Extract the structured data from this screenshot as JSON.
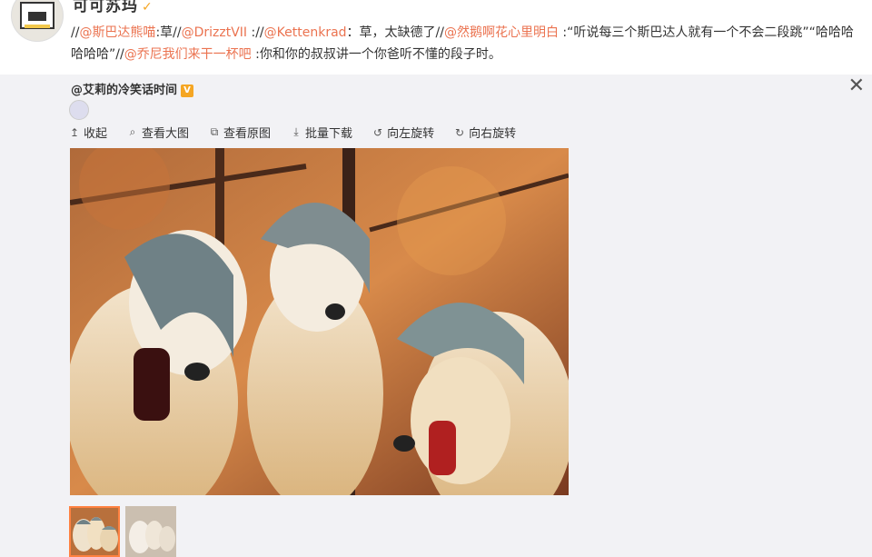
{
  "post": {
    "username": "可可苏玛",
    "segments": [
      {
        "text": "//",
        "type": "plain"
      },
      {
        "text": "@斯巴达熊喵",
        "type": "mention"
      },
      {
        "text": ":草//",
        "type": "plain"
      },
      {
        "text": "@DrizztVII",
        "type": "mention"
      },
      {
        "text": " ://",
        "type": "plain"
      },
      {
        "text": "@Kettenkrad",
        "type": "mention"
      },
      {
        "text": "：草，太缺德了//",
        "type": "plain"
      },
      {
        "text": "@然鹅啊花心里明白",
        "type": "mention"
      },
      {
        "text": " :“听说每三个斯巴达人就有一个不会二段跳”",
        "type": "plain"
      },
      {
        "text": "“哈哈哈哈哈哈”//",
        "type": "plain"
      },
      {
        "text": "@乔尼我们来干一杯吧",
        "type": "mention"
      },
      {
        "text": " :你和你的叔叔讲一个你爸听不懂的段子时。",
        "type": "plain"
      }
    ]
  },
  "viewer": {
    "author": "@艾莉的冷笑话时间",
    "close_label": "✕",
    "toolbar": [
      {
        "label": "收起",
        "icon": "arrow-up-icon",
        "glyph": "↥"
      },
      {
        "label": "查看大图",
        "icon": "magnifier-icon",
        "glyph": "⌕"
      },
      {
        "label": "查看原图",
        "icon": "external-link-icon",
        "glyph": "⧉"
      },
      {
        "label": "批量下载",
        "icon": "download-icon",
        "glyph": "⤓"
      },
      {
        "label": "向左旋转",
        "icon": "rotate-left-icon",
        "glyph": "↺"
      },
      {
        "label": "向右旋转",
        "icon": "rotate-right-icon",
        "glyph": "↻"
      }
    ],
    "thumbnails": [
      {
        "selected": true
      },
      {
        "selected": false
      }
    ]
  },
  "colors": {
    "mention": "#eb7350",
    "viewer_bg": "#f2f2f5",
    "thumb_active": "#ff8140",
    "badge": "#f5a623"
  }
}
